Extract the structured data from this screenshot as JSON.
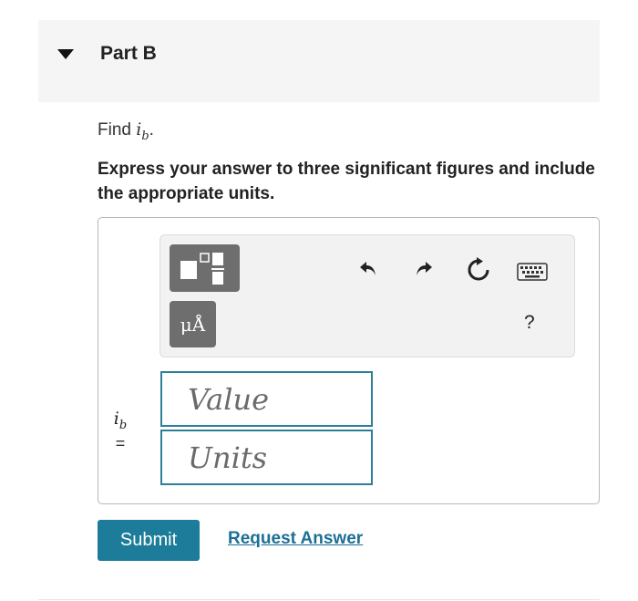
{
  "part": {
    "title": "Part B"
  },
  "question": {
    "find_prefix": "Find",
    "variable": "i",
    "variable_subscript": "b",
    "find_suffix": ".",
    "instructions": "Express your answer to three significant figures and include the appropriate units."
  },
  "toolbar": {
    "units_label": "μÅ",
    "help_label": "?",
    "icons": [
      "templates-icon",
      "units-icon",
      "undo-icon",
      "redo-icon",
      "reset-icon",
      "keyboard-icon",
      "help-icon"
    ]
  },
  "answer": {
    "lhs_variable": "i",
    "lhs_subscript": "b",
    "equals": "=",
    "value_placeholder": "Value",
    "units_placeholder": "Units"
  },
  "actions": {
    "submit_label": "Submit",
    "request_label": "Request Answer"
  },
  "colors": {
    "accent": "#1c7c99",
    "field_border": "#2d7f98",
    "link": "#1c6f96",
    "toolbar_button": "#6e6e6e"
  }
}
